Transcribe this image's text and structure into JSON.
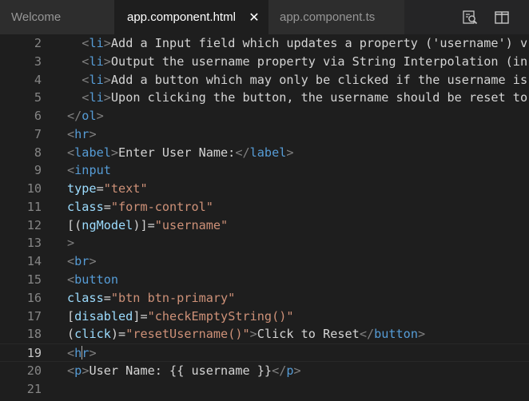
{
  "tabs": [
    {
      "label": "Welcome",
      "active": false
    },
    {
      "label": "app.component.html",
      "active": true
    },
    {
      "label": "app.component.ts",
      "active": false
    }
  ],
  "tab_close_glyph": "✕",
  "actions": [
    {
      "icon": "open-preview-icon"
    },
    {
      "icon": "split-editor-icon"
    }
  ],
  "colors": {
    "editor_bg": "#1e1e1e",
    "tab_inactive_bg": "#2d2d2d",
    "line_number": "#858585",
    "tag": "#569cd6",
    "attribute": "#9cdcfe",
    "string": "#ce9178",
    "text": "#d4d4d4",
    "punctuation": "#808080"
  },
  "editor": {
    "current_line": 19,
    "lines": [
      {
        "num": "2",
        "tokens": [
          {
            "t": "  ",
            "k": "text"
          },
          {
            "t": "<",
            "k": "punc"
          },
          {
            "t": "li",
            "k": "tag"
          },
          {
            "t": ">",
            "k": "punc"
          },
          {
            "t": "Add a Input field which updates a property ('username') v",
            "k": "text"
          }
        ]
      },
      {
        "num": "3",
        "tokens": [
          {
            "t": "  ",
            "k": "text"
          },
          {
            "t": "<",
            "k": "punc"
          },
          {
            "t": "li",
            "k": "tag"
          },
          {
            "t": ">",
            "k": "punc"
          },
          {
            "t": "Output the username property via String Interpolation (in",
            "k": "text"
          }
        ]
      },
      {
        "num": "4",
        "tokens": [
          {
            "t": "  ",
            "k": "text"
          },
          {
            "t": "<",
            "k": "punc"
          },
          {
            "t": "li",
            "k": "tag"
          },
          {
            "t": ">",
            "k": "punc"
          },
          {
            "t": "Add a button which may only be clicked if the username is",
            "k": "text"
          }
        ]
      },
      {
        "num": "5",
        "tokens": [
          {
            "t": "  ",
            "k": "text"
          },
          {
            "t": "<",
            "k": "punc"
          },
          {
            "t": "li",
            "k": "tag"
          },
          {
            "t": ">",
            "k": "punc"
          },
          {
            "t": "Upon clicking the button, the username should be reset to",
            "k": "text"
          }
        ]
      },
      {
        "num": "6",
        "tokens": [
          {
            "t": "</",
            "k": "punc"
          },
          {
            "t": "ol",
            "k": "tag"
          },
          {
            "t": ">",
            "k": "punc"
          }
        ]
      },
      {
        "num": "7",
        "tokens": [
          {
            "t": "<",
            "k": "punc"
          },
          {
            "t": "hr",
            "k": "tag"
          },
          {
            "t": ">",
            "k": "punc"
          }
        ]
      },
      {
        "num": "8",
        "tokens": [
          {
            "t": "<",
            "k": "punc"
          },
          {
            "t": "label",
            "k": "tag"
          },
          {
            "t": ">",
            "k": "punc"
          },
          {
            "t": "Enter User Name:",
            "k": "text"
          },
          {
            "t": "</",
            "k": "punc"
          },
          {
            "t": "label",
            "k": "tag"
          },
          {
            "t": ">",
            "k": "punc"
          }
        ]
      },
      {
        "num": "9",
        "tokens": [
          {
            "t": "<",
            "k": "punc"
          },
          {
            "t": "input",
            "k": "tag"
          }
        ]
      },
      {
        "num": "10",
        "tokens": [
          {
            "t": "type",
            "k": "attr"
          },
          {
            "t": "=",
            "k": "text"
          },
          {
            "t": "\"text\"",
            "k": "str"
          }
        ]
      },
      {
        "num": "11",
        "tokens": [
          {
            "t": "class",
            "k": "attr"
          },
          {
            "t": "=",
            "k": "text"
          },
          {
            "t": "\"form-control\"",
            "k": "str"
          }
        ]
      },
      {
        "num": "12",
        "tokens": [
          {
            "t": "[(",
            "k": "text"
          },
          {
            "t": "ngModel",
            "k": "attr"
          },
          {
            "t": ")]",
            "k": "text"
          },
          {
            "t": "=",
            "k": "text"
          },
          {
            "t": "\"username\"",
            "k": "str"
          }
        ]
      },
      {
        "num": "13",
        "tokens": [
          {
            "t": ">",
            "k": "punc"
          }
        ]
      },
      {
        "num": "14",
        "tokens": [
          {
            "t": "<",
            "k": "punc"
          },
          {
            "t": "br",
            "k": "tag"
          },
          {
            "t": ">",
            "k": "punc"
          }
        ]
      },
      {
        "num": "15",
        "tokens": [
          {
            "t": "<",
            "k": "punc"
          },
          {
            "t": "button",
            "k": "tag"
          }
        ]
      },
      {
        "num": "16",
        "tokens": [
          {
            "t": "class",
            "k": "attr"
          },
          {
            "t": "=",
            "k": "text"
          },
          {
            "t": "\"btn btn-primary\"",
            "k": "str"
          }
        ]
      },
      {
        "num": "17",
        "tokens": [
          {
            "t": "[",
            "k": "text"
          },
          {
            "t": "disabled",
            "k": "attr"
          },
          {
            "t": "]",
            "k": "text"
          },
          {
            "t": "=",
            "k": "text"
          },
          {
            "t": "\"checkEmptyString()\"",
            "k": "str"
          }
        ]
      },
      {
        "num": "18",
        "tokens": [
          {
            "t": "(",
            "k": "text"
          },
          {
            "t": "click",
            "k": "attr"
          },
          {
            "t": ")",
            "k": "text"
          },
          {
            "t": "=",
            "k": "text"
          },
          {
            "t": "\"resetUsername()\"",
            "k": "str"
          },
          {
            "t": ">",
            "k": "punc"
          },
          {
            "t": "Click to Reset",
            "k": "text"
          },
          {
            "t": "</",
            "k": "punc"
          },
          {
            "t": "button",
            "k": "tag"
          },
          {
            "t": ">",
            "k": "punc"
          }
        ]
      },
      {
        "num": "19",
        "tokens": [
          {
            "t": "<",
            "k": "punc"
          },
          {
            "t": "h",
            "k": "tag"
          },
          {
            "t": "",
            "k": "cursor"
          },
          {
            "t": "r",
            "k": "tag"
          },
          {
            "t": ">",
            "k": "punc"
          }
        ]
      },
      {
        "num": "20",
        "tokens": [
          {
            "t": "<",
            "k": "punc"
          },
          {
            "t": "p",
            "k": "tag"
          },
          {
            "t": ">",
            "k": "punc"
          },
          {
            "t": "User Name: {{ username }}",
            "k": "text"
          },
          {
            "t": "</",
            "k": "punc"
          },
          {
            "t": "p",
            "k": "tag"
          },
          {
            "t": ">",
            "k": "punc"
          }
        ]
      },
      {
        "num": "21",
        "tokens": []
      }
    ]
  }
}
